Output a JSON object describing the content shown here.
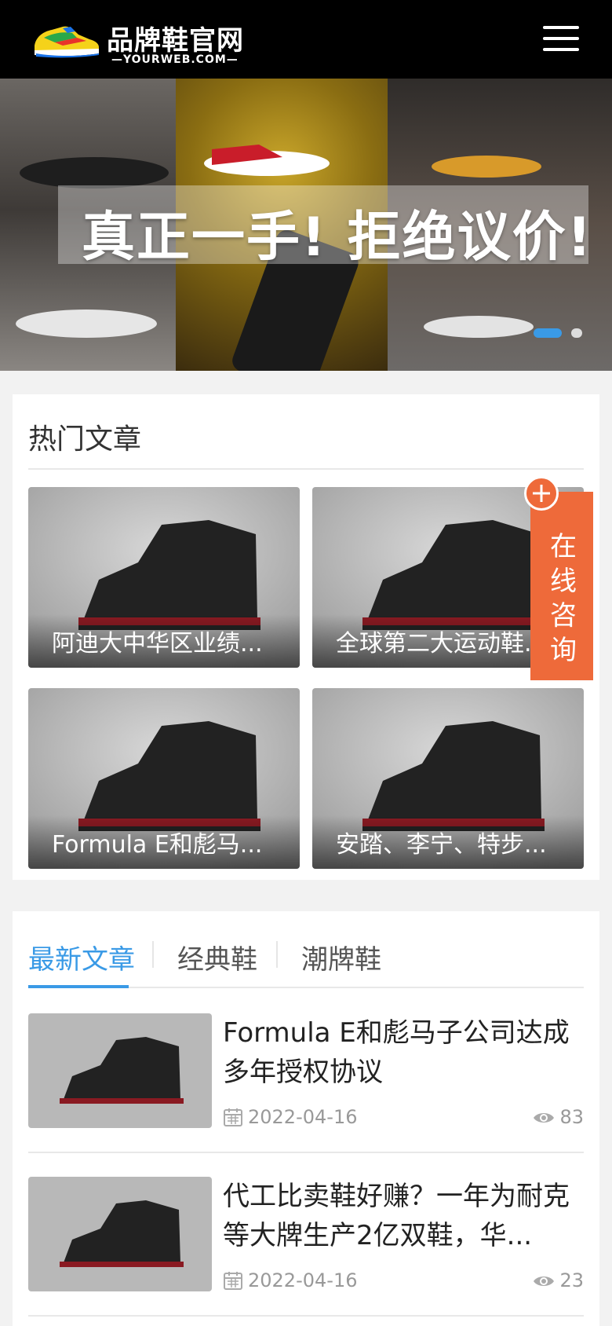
{
  "header": {
    "logo_title": "品牌鞋官网",
    "logo_subtitle": "—YOURWEB.COM—",
    "logo_icon": "sneaker-logo-icon",
    "menu_icon": "hamburger-menu-icon"
  },
  "banner": {
    "caption": "真正一手! 拒绝议价!",
    "active_slide": 1,
    "slide_count": 2
  },
  "hot": {
    "title": "热门文章",
    "items": [
      {
        "label": "阿迪大中华区业绩..."
      },
      {
        "label": "全球第二大运动鞋..."
      },
      {
        "label": "Formula E和彪马..."
      },
      {
        "label": "安踏、李宁、特步..."
      }
    ]
  },
  "consult": {
    "label": "在线咨询",
    "icon": "plus-icon"
  },
  "tabs": [
    "最新文章",
    "经典鞋",
    "潮牌鞋"
  ],
  "active_tab": 0,
  "news": [
    {
      "title": "Formula E和彪马子公司达成多年授权协议",
      "date": "2022-04-16",
      "views": "83"
    },
    {
      "title": "代工比卖鞋好赚？一年为耐克等大牌生产2亿双鞋，华...",
      "date": "2022-04-16",
      "views": "23"
    }
  ],
  "colors": {
    "accent": "#3a9ae6",
    "consult": "#ee6a3a",
    "header_bg": "#000000"
  }
}
